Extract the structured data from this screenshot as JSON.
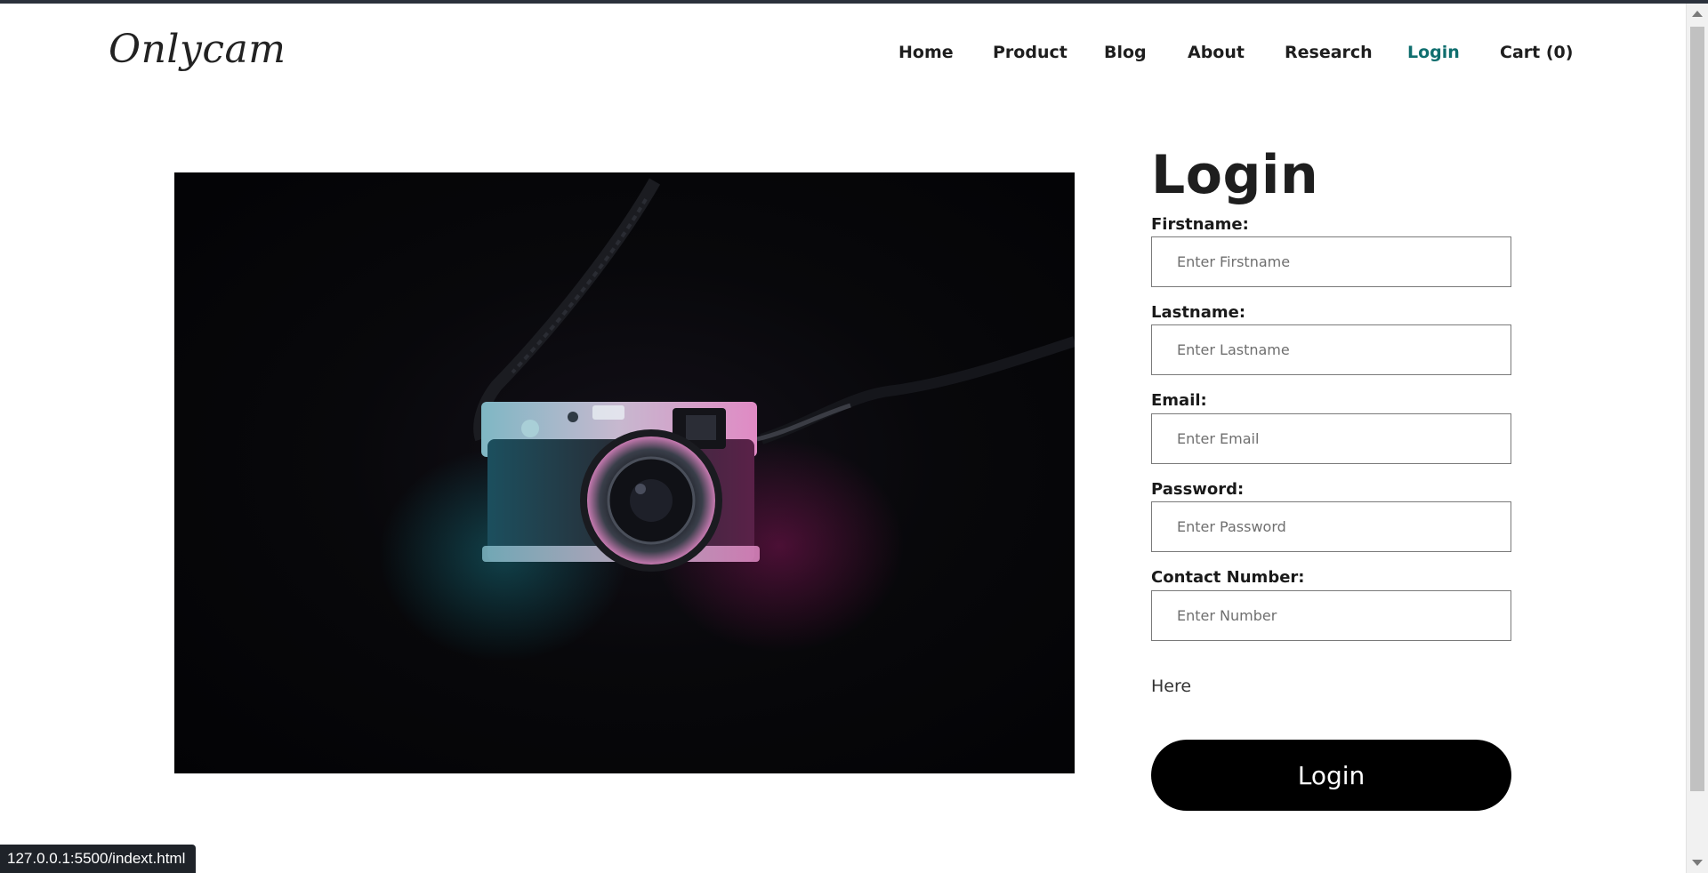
{
  "brand": {
    "logo_text": "Onlycam"
  },
  "nav": {
    "items": [
      {
        "label": "Home"
      },
      {
        "label": "Product"
      },
      {
        "label": "Blog"
      },
      {
        "label": "About"
      },
      {
        "label": "Research"
      },
      {
        "label": "Login",
        "active": true
      },
      {
        "label": "Cart (0)"
      }
    ],
    "active_color": "#0f6e6e"
  },
  "hero": {
    "image_subject": "camera-photo"
  },
  "form": {
    "title": "Login",
    "fields": [
      {
        "label": "Firstname:",
        "placeholder": "Enter Firstname",
        "value": ""
      },
      {
        "label": "Lastname:",
        "placeholder": "Enter Lastname",
        "value": ""
      },
      {
        "label": "Email:",
        "placeholder": "Enter Email",
        "value": ""
      },
      {
        "label": "Password:",
        "placeholder": "Enter Password",
        "value": ""
      },
      {
        "label": "Contact Number:",
        "placeholder": "Enter Number",
        "value": ""
      }
    ],
    "extra_text": "Here",
    "submit_label": "Login",
    "submit_color": "#000000"
  },
  "status_bar": {
    "url": "127.0.0.1:5500/indext.html"
  }
}
